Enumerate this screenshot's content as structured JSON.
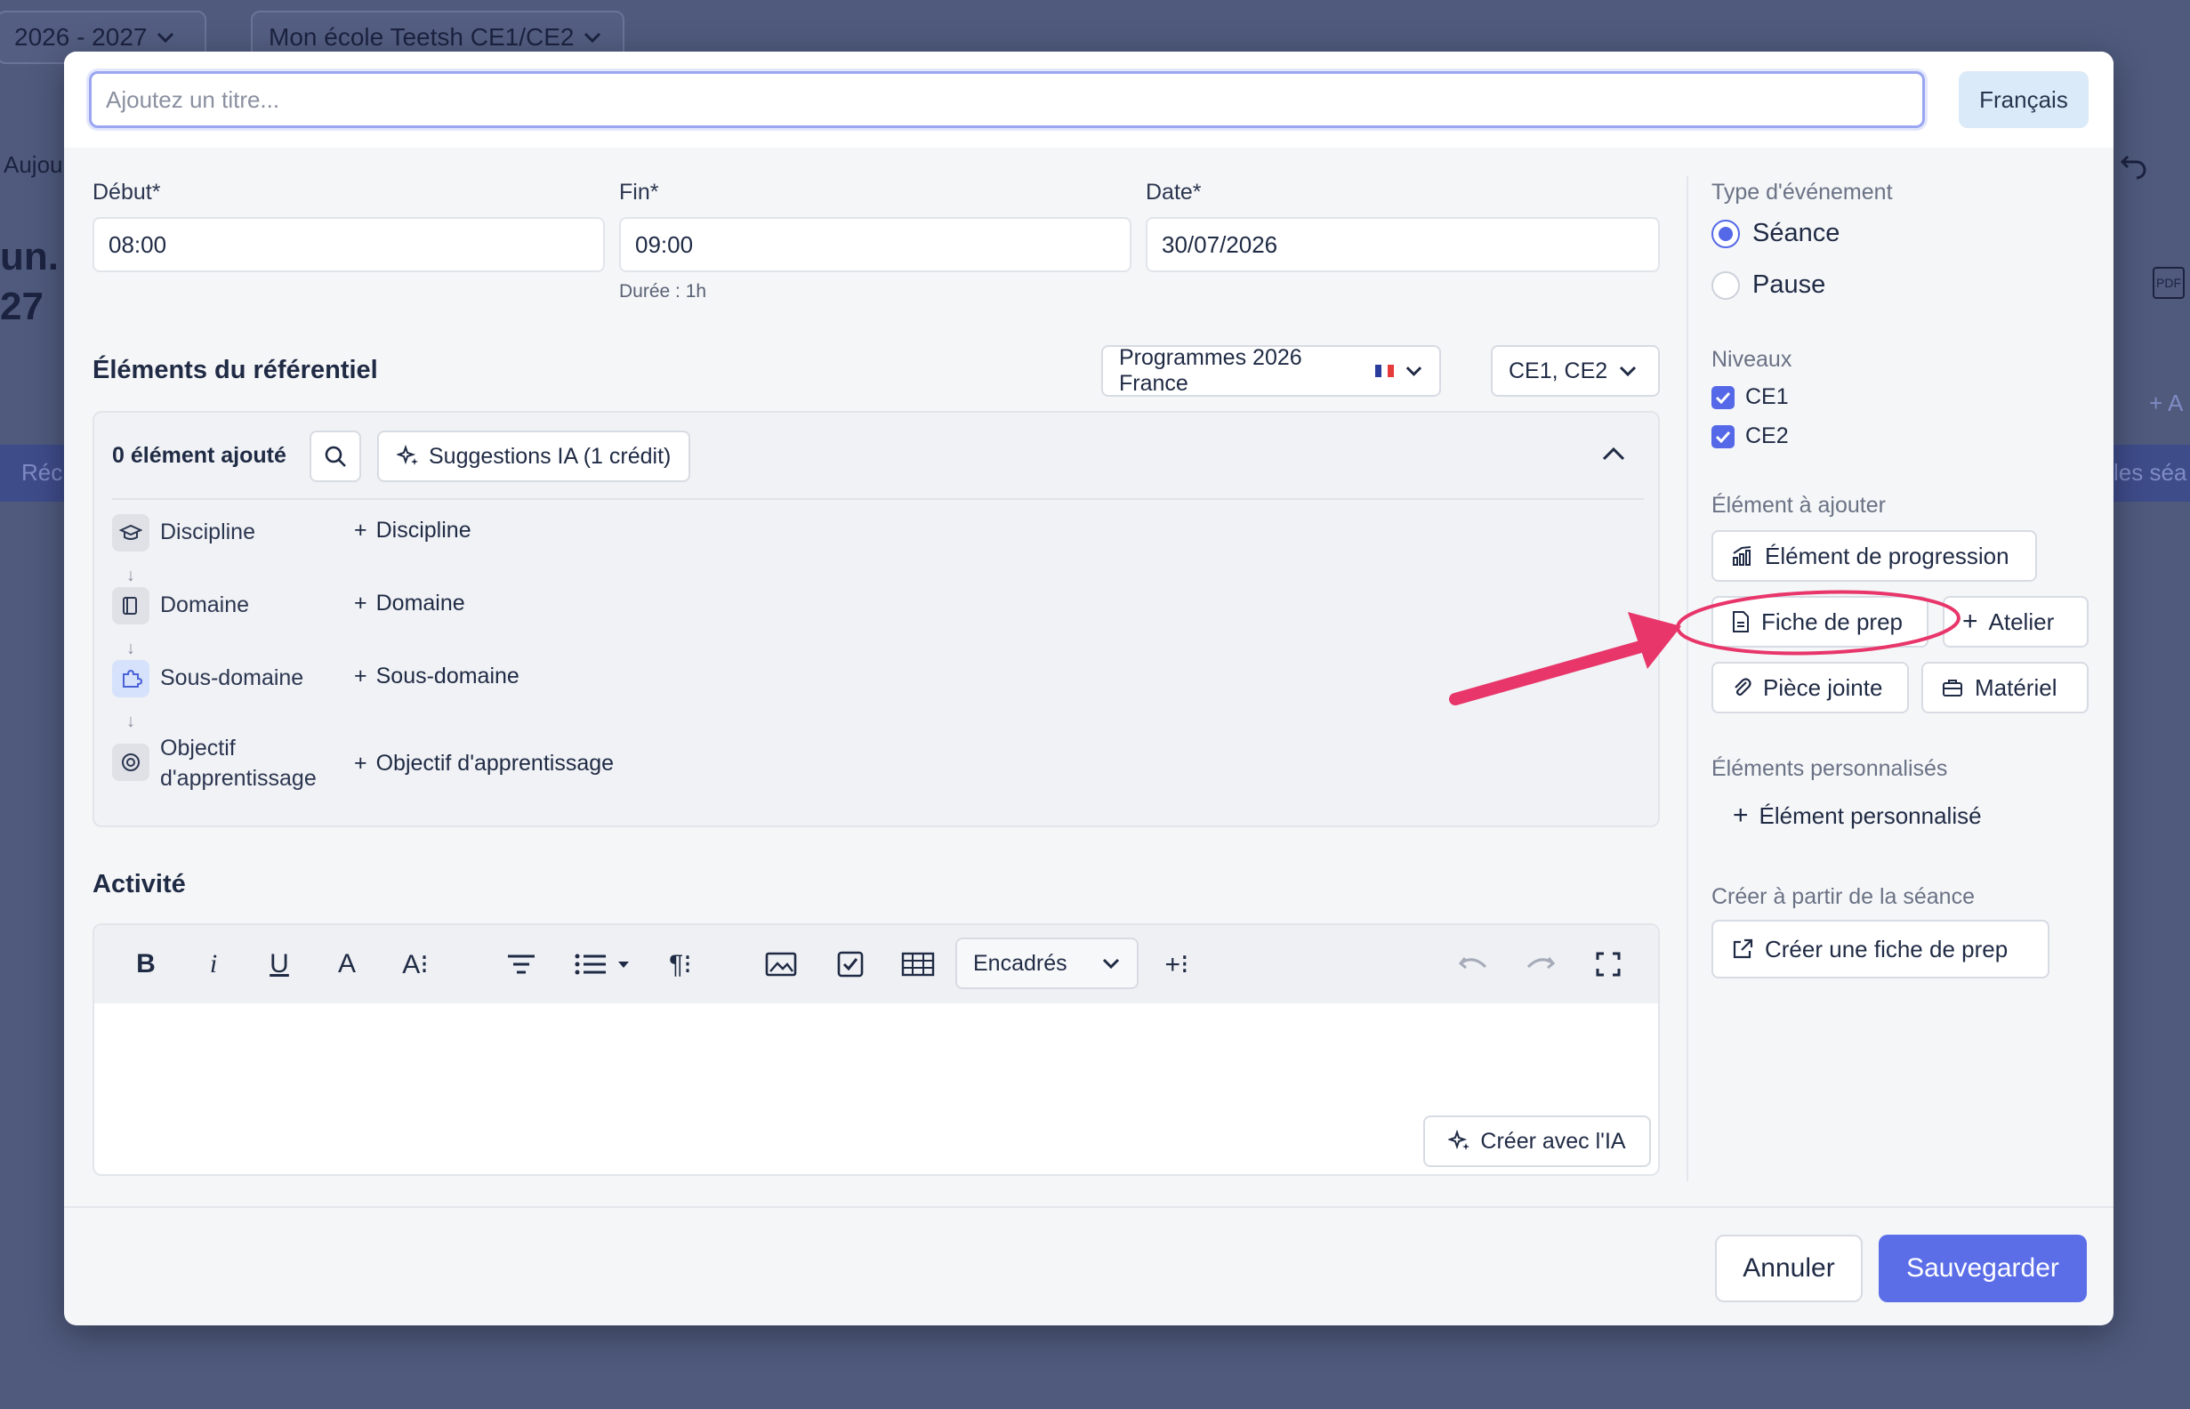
{
  "background": {
    "year_selector": "2026 - 2027",
    "school_selector": "Mon école Teetsh CE1/CE2",
    "today_label": "Aujou",
    "big_text_1": "un.",
    "big_text_2": "27",
    "band_left": "Réc",
    "band_right": "les séa",
    "side_add": "+ A",
    "pdf_label": "PDF"
  },
  "title": {
    "placeholder": "Ajoutez un titre..."
  },
  "language_button": "Français",
  "time": {
    "start_label": "Début*",
    "start_value": "08:00",
    "end_label": "Fin*",
    "end_value": "09:00",
    "date_label": "Date*",
    "date_value": "30/07/2026",
    "duration": "Durée : 1h"
  },
  "referential": {
    "title": "Éléments du référentiel",
    "program_dropdown": "Programmes 2026 France",
    "levels_dropdown": "CE1, CE2",
    "count_label": "0 élément ajouté",
    "suggestions_button": "Suggestions IA (1 crédit)",
    "rows": [
      {
        "label": "Discipline",
        "add": "Discipline",
        "icon": "graduation-cap-icon"
      },
      {
        "label": "Domaine",
        "add": "Domaine",
        "icon": "book-icon"
      },
      {
        "label": "Sous-domaine",
        "add": "Sous-domaine",
        "icon": "puzzle-icon"
      },
      {
        "label_line1": "Objectif",
        "label_line2": "d'apprentissage",
        "add": "Objectif d'apprentissage",
        "icon": "target-icon"
      }
    ]
  },
  "activity": {
    "title": "Activité",
    "encadres_label": "Encadrés",
    "ai_button": "Créer avec l'IA"
  },
  "sidebar": {
    "event_type_label": "Type d'événement",
    "event_types": [
      {
        "label": "Séance",
        "selected": true
      },
      {
        "label": "Pause",
        "selected": false
      }
    ],
    "levels_label": "Niveaux",
    "levels": [
      {
        "label": "CE1",
        "checked": true
      },
      {
        "label": "CE2",
        "checked": true
      }
    ],
    "add_element_label": "Élément à ajouter",
    "progression_button": "Élément de progression",
    "fiche_button": "Fiche de prep",
    "atelier_button": "Atelier",
    "piece_button": "Pièce jointe",
    "materiel_button": "Matériel",
    "custom_label": "Éléments personnalisés",
    "custom_add": "Élément personnalisé",
    "create_label": "Créer à partir de la séance",
    "create_button": "Créer une fiche de prep"
  },
  "footer": {
    "cancel": "Annuler",
    "save": "Sauvegarder"
  },
  "colors": {
    "accent": "#5468e8",
    "annotation": "#e8356a",
    "backdrop": "#4f5a7d"
  }
}
